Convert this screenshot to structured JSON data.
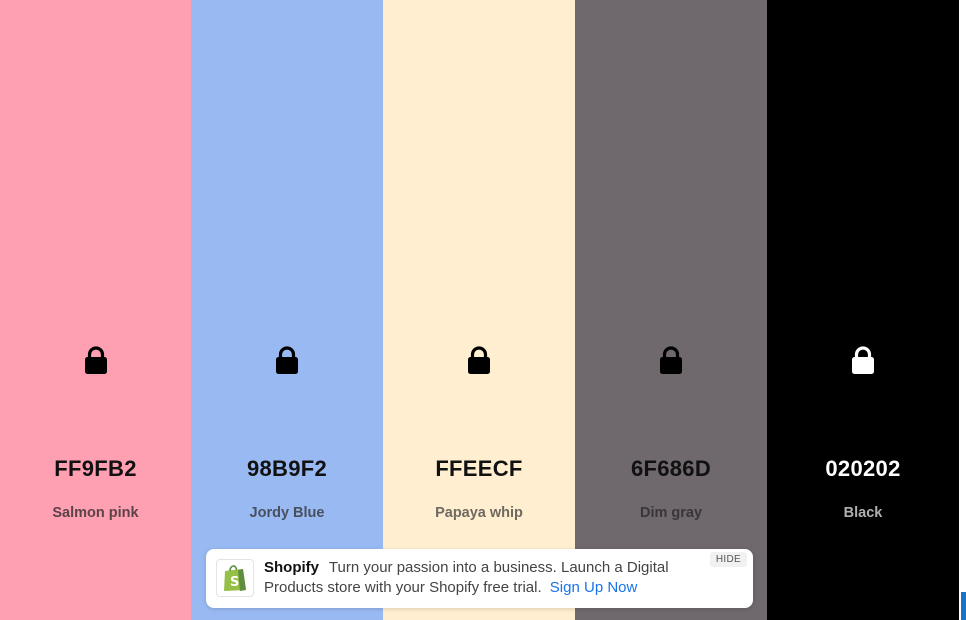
{
  "colors": [
    {
      "hex": "FF9FB2",
      "name": "Salmon pink",
      "background": "#FF9FB2",
      "text_color": "#111111",
      "name_color": "#5a4448",
      "lock_color": "#000000"
    },
    {
      "hex": "98B9F2",
      "name": "Jordy Blue",
      "background": "#98B9F2",
      "text_color": "#111111",
      "name_color": "#48505e",
      "lock_color": "#000000"
    },
    {
      "hex": "FFEECF",
      "name": "Papaya whip",
      "background": "#FFEECF",
      "text_color": "#111111",
      "name_color": "#6e6a62",
      "lock_color": "#000000"
    },
    {
      "hex": "6F686D",
      "name": "Dim gray",
      "background": "#6F686D",
      "text_color": "#111111",
      "name_color": "#3a3539",
      "lock_color": "#000000"
    },
    {
      "hex": "020202",
      "name": "Black",
      "background": "#000000",
      "text_color": "#ffffff",
      "name_color": "#b0b0b0",
      "lock_color": "#ffffff"
    }
  ],
  "ad": {
    "brand": "Shopify",
    "message": "Turn your passion into a business. Launch a Digital Products store with your Shopify free trial.",
    "cta": "Sign Up Now",
    "hide_label": "HIDE",
    "logo_icon": "shopify-bag-icon",
    "accent": "#1a73e8"
  },
  "icons": {
    "lock": "lock-icon"
  }
}
